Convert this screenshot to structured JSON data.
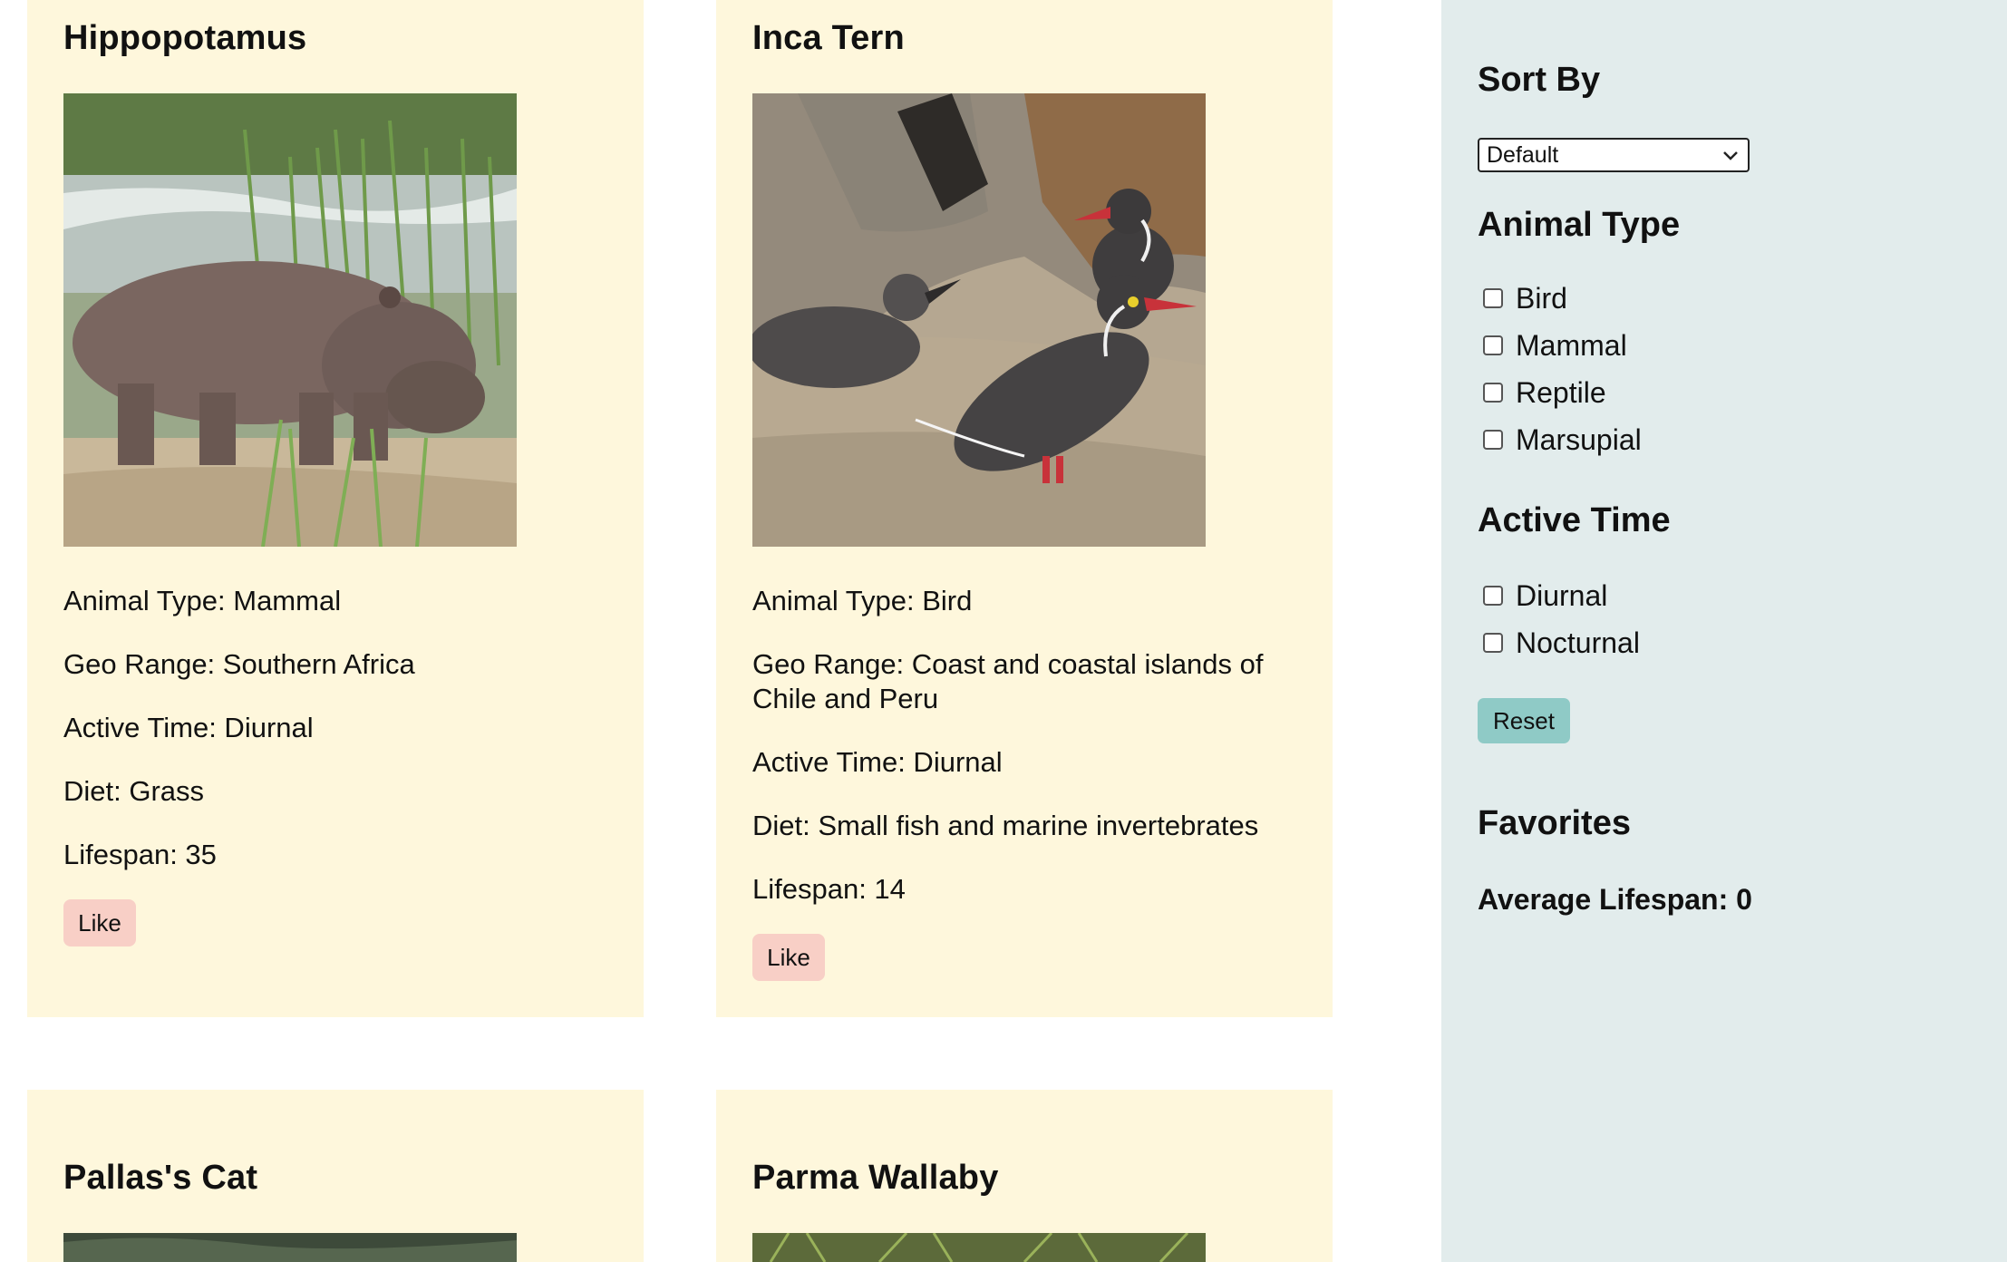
{
  "cards": [
    {
      "name": "Hippopotamus",
      "animal_type": "Animal Type: Mammal",
      "geo_range": "Geo Range: Southern Africa",
      "active_time": "Active Time: Diurnal",
      "diet": "Diet: Grass",
      "lifespan": "Lifespan: 35",
      "like_label": "Like"
    },
    {
      "name": "Inca Tern",
      "animal_type": "Animal Type: Bird",
      "geo_range_line1": "Geo Range: Coast and coastal islands of",
      "geo_range_line2": "Chile and Peru",
      "active_time": "Active Time: Diurnal",
      "diet": "Diet: Small fish and marine invertebrates",
      "lifespan": "Lifespan: 14",
      "like_label": "Like"
    },
    {
      "name": "Pallas's Cat"
    },
    {
      "name": "Parma Wallaby"
    }
  ],
  "sidebar": {
    "sort_heading": "Sort By",
    "sort_value": "Default",
    "type_heading": "Animal Type",
    "type_options": [
      "Bird",
      "Mammal",
      "Reptile",
      "Marsupial"
    ],
    "time_heading": "Active Time",
    "time_options": [
      "Diurnal",
      "Nocturnal"
    ],
    "reset_label": "Reset",
    "favorites_heading": "Favorites",
    "average_lifespan": "Average Lifespan: 0"
  },
  "colors": {
    "card_bg": "#fef7dc",
    "sidebar_bg": "#e2ecec",
    "like_button": "#f8cfc6",
    "reset_button": "#8fcac6"
  }
}
